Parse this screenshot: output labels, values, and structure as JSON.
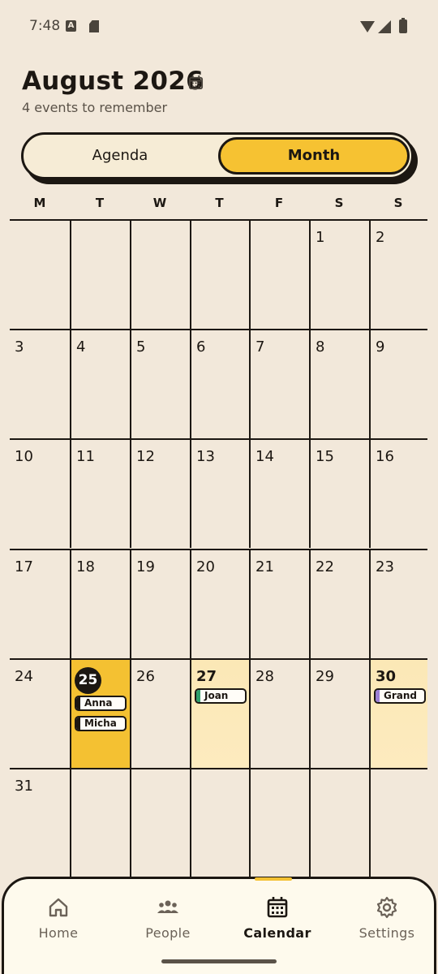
{
  "status_bar": {
    "time": "7:48",
    "a_glyph": "A"
  },
  "header": {
    "title": "August 2026",
    "subtitle": "4 events to remember"
  },
  "toggle": {
    "agenda_label": "Agenda",
    "month_label": "Month",
    "selected": "Month"
  },
  "weekdays": [
    "M",
    "T",
    "W",
    "T",
    "F",
    "S",
    "S"
  ],
  "calendar": {
    "weeks": [
      [
        {
          "day": ""
        },
        {
          "day": ""
        },
        {
          "day": ""
        },
        {
          "day": ""
        },
        {
          "day": ""
        },
        {
          "day": "1"
        },
        {
          "day": "2"
        }
      ],
      [
        {
          "day": "3"
        },
        {
          "day": "4"
        },
        {
          "day": "5"
        },
        {
          "day": "6"
        },
        {
          "day": "7"
        },
        {
          "day": "8"
        },
        {
          "day": "9"
        }
      ],
      [
        {
          "day": "10"
        },
        {
          "day": "11"
        },
        {
          "day": "12"
        },
        {
          "day": "13"
        },
        {
          "day": "14"
        },
        {
          "day": "15"
        },
        {
          "day": "16"
        }
      ],
      [
        {
          "day": "17"
        },
        {
          "day": "18"
        },
        {
          "day": "19"
        },
        {
          "day": "20"
        },
        {
          "day": "21"
        },
        {
          "day": "22"
        },
        {
          "day": "23"
        }
      ],
      [
        {
          "day": "24"
        },
        {
          "day": "25",
          "today": true,
          "events": [
            {
              "label": "Anna",
              "color": "#1c1712"
            },
            {
              "label": "Micha",
              "color": "#1c1712"
            }
          ]
        },
        {
          "day": "26"
        },
        {
          "day": "27",
          "events": [
            {
              "label": "Joan",
              "color": "#2e9e6b"
            }
          ]
        },
        {
          "day": "28"
        },
        {
          "day": "29"
        },
        {
          "day": "30",
          "events": [
            {
              "label": "Grand",
              "color": "#9b7fd4"
            }
          ]
        }
      ],
      [
        {
          "day": "31"
        },
        {
          "day": ""
        },
        {
          "day": ""
        },
        {
          "day": ""
        },
        {
          "day": ""
        },
        {
          "day": ""
        },
        {
          "day": ""
        }
      ]
    ]
  },
  "colors": {
    "background": "#f2e8da",
    "accent": "#f4c132",
    "event_tint": "#fbe8b6",
    "ink": "#1c1712"
  },
  "bottom_nav": {
    "items": [
      {
        "label": "Home",
        "icon": "home-icon",
        "active": false
      },
      {
        "label": "People",
        "icon": "people-icon",
        "active": false
      },
      {
        "label": "Calendar",
        "icon": "calendar-icon",
        "active": true
      },
      {
        "label": "Settings",
        "icon": "gear-icon",
        "active": false
      }
    ]
  }
}
